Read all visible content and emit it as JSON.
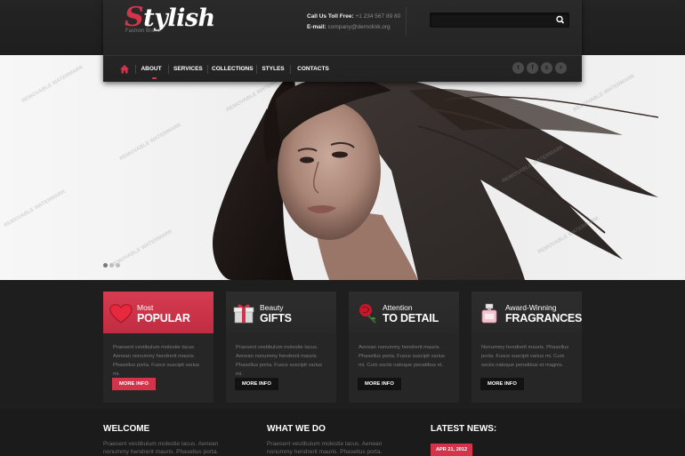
{
  "brand": {
    "logo_first": "S",
    "logo_rest": "tylish",
    "tagline": "Fashion Brand",
    "accent": "#d3344a"
  },
  "contact": {
    "phone_label": "Call Us Toll Free:",
    "phone_value": "+1 234 567 89 80",
    "email_label": "E-mail:",
    "email_value": "company@demolink.org"
  },
  "search": {
    "placeholder": "",
    "icon": "search-icon"
  },
  "nav": {
    "home_icon": "home-icon",
    "items": [
      {
        "label": "ABOUT"
      },
      {
        "label": "SERVICES"
      },
      {
        "label": "COLLECTIONS"
      },
      {
        "label": "STYLES"
      },
      {
        "label": "CONTACTS"
      }
    ],
    "active_index": 0,
    "social": [
      {
        "icon": "twitter-icon",
        "glyph": "t"
      },
      {
        "icon": "facebook-icon",
        "glyph": "f"
      },
      {
        "icon": "skype-icon",
        "glyph": "s"
      },
      {
        "icon": "rss-icon",
        "glyph": "r"
      }
    ]
  },
  "hero": {
    "watermark": "REMOVABLE WATERMARK",
    "slides": 3,
    "active_slide": 0
  },
  "features": [
    {
      "small": "Most",
      "big": "POPULAR",
      "text": "Praesent vestibulum molestie lacus. Aenean nonummy hendrerit mauris. Phasellus porta. Fusce suscipit varius mi.",
      "button": "MORE INFO",
      "icon": "heart-icon"
    },
    {
      "small": "Beauty",
      "big": "GIFTS",
      "text": "Praesent vestibulum molestie lacus. Aenean nonummy hendrerit mauris. Phasellus porta. Fusce suscipit varius mi.",
      "button": "MORE INFO",
      "icon": "gift-icon"
    },
    {
      "small": "Attention",
      "big": "TO DETAIL",
      "text": "Aenean nonummy hendrerit mauris. Phasellus porta. Fusce suscipit varius mi. Cum sociis natoque penatibus et.",
      "button": "MORE INFO",
      "icon": "rose-icon"
    },
    {
      "small": "Award-Winning",
      "big": "FRAGRANCES",
      "text": "Nonummy hendrerit mauris. Phasellus porta. Fusce suscipit varius mi. Cum sociis natoque penatibus et magnis.",
      "button": "MORE INFO",
      "icon": "perfume-icon"
    }
  ],
  "bottom": {
    "welcome_title": "WELCOME",
    "welcome_text": "Praesent vestibulum molestie lacus. Aenean nonummy hendrerit mauris. Phasellus porta.",
    "whatwedo_title": "WHAT WE DO",
    "whatwedo_text": "Praesent vestibulum molestie lacus. Aenean nonummy hendrerit mauris. Phasellus porta.",
    "news_title": "LATEST NEWS:",
    "news_date": "APR 21, 2012"
  }
}
